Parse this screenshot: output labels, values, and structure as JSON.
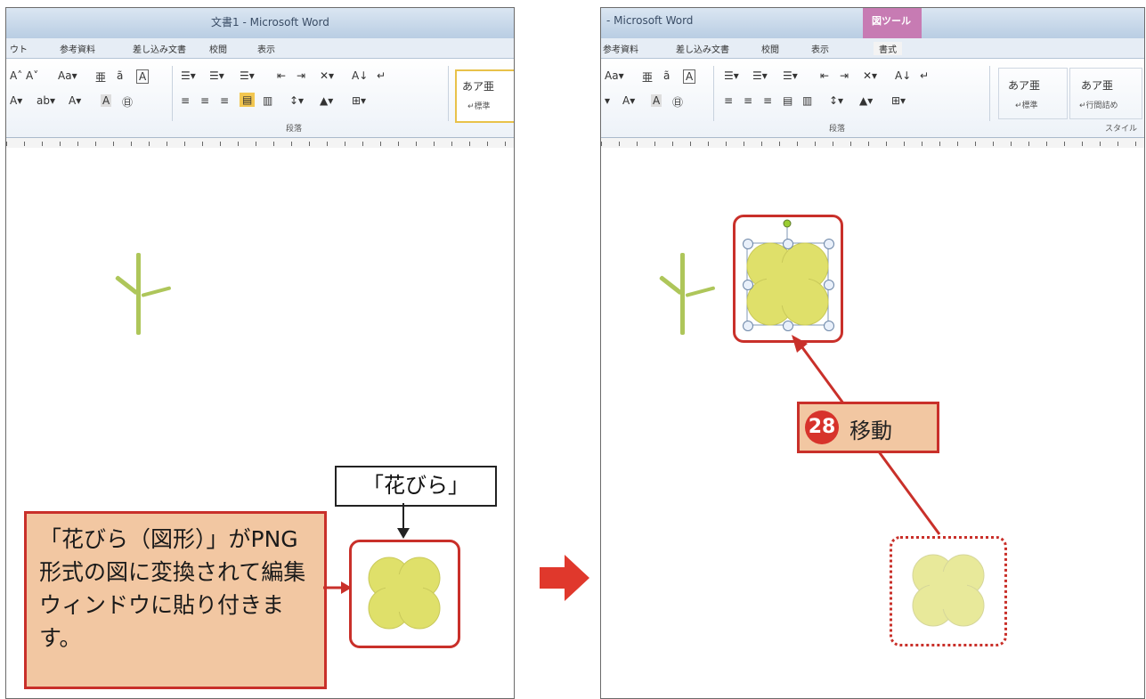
{
  "left_window": {
    "title": "文書1 - Microsoft Word",
    "tabs": [
      "ウト",
      "参考資料",
      "差し込み文書",
      "校閲",
      "表示"
    ],
    "ribbon_row1": [
      "A˄ A˅",
      "Aa▾",
      "亜",
      "ã",
      "A",
      "☰▾",
      "☰▾",
      "☰▾",
      "⇤",
      "⇥",
      "✕▾",
      "A↓",
      "↵"
    ],
    "ribbon_row2": [
      "A▾",
      "ab▾",
      "A▾",
      "A",
      "㊐",
      "≡",
      "≡",
      "≡",
      "▤",
      "▥",
      "↕▾",
      "▲▾",
      "⊞▾"
    ],
    "group_label": "段落",
    "style_sample": "あア亜",
    "style_name": "↵標準"
  },
  "right_window": {
    "title": "- Microsoft Word",
    "context_tab": "図ツール",
    "tabs": [
      "参考資料",
      "差し込み文書",
      "校閲",
      "表示",
      "書式"
    ],
    "ribbon_row1": [
      "Aa▾",
      "亜",
      "ã",
      "A",
      "☰▾",
      "☰▾",
      "☰▾",
      "⇤",
      "⇥",
      "✕▾",
      "A↓",
      "↵"
    ],
    "ribbon_row2": [
      "▾",
      "A▾",
      "A",
      "㊐",
      "≡",
      "≡",
      "≡",
      "▤",
      "▥",
      "↕▾",
      "▲▾",
      "⊞▾"
    ],
    "group_label": "段落",
    "style_samples": [
      {
        "sample": "あア亜",
        "name": "↵標準"
      },
      {
        "sample": "あア亜",
        "name": "↵行間詰め"
      }
    ],
    "style_group_label": "スタイル"
  },
  "annotations": {
    "petal_label": "「花びら」",
    "callout_text": "「花びら（図形）」がPNG 形式の図に変換されて編集ウィンドウに貼り付きます。",
    "step_number": "28",
    "step_text": "移動"
  },
  "colors": {
    "annotation_red": "#c9302a",
    "callout_fill": "#f2c7a2",
    "petal_yellow": "#dfe06a",
    "stem_green": "#aec65a",
    "context_tab": "#c77bb3"
  }
}
